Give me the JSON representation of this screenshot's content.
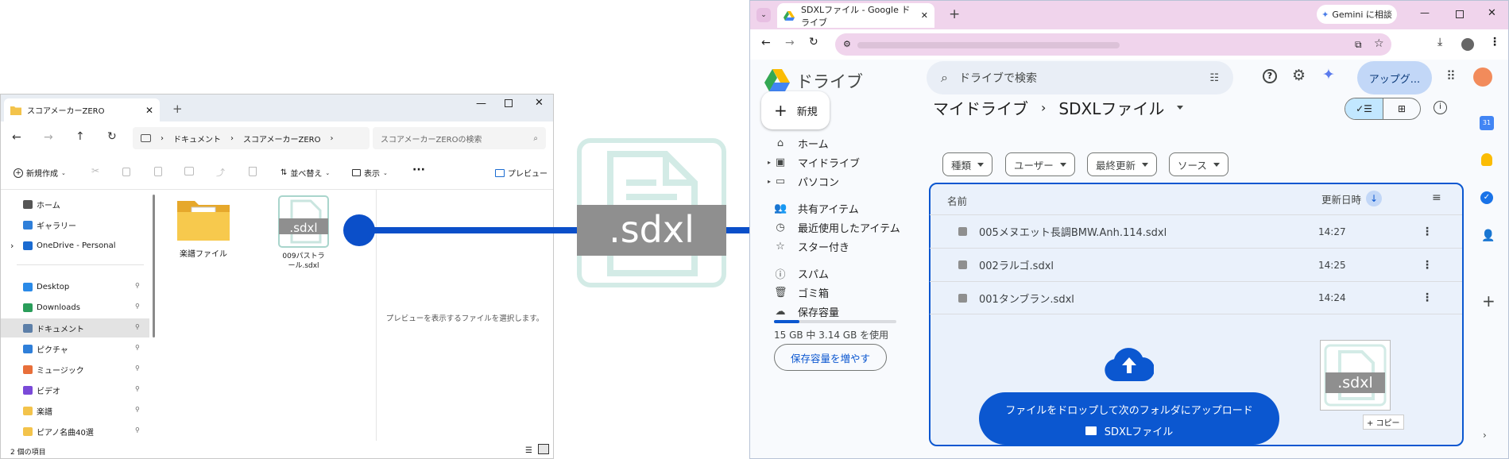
{
  "explorer": {
    "tab_title": "スコアメーカーZERO",
    "breadcrumb": [
      "ドキュメント",
      "スコアメーカーZERO"
    ],
    "search_placeholder": "スコアメーカーZEROの検索",
    "toolbar": {
      "new": "新規作成",
      "sort": "並べ替え",
      "view": "表示",
      "preview": "プレビュー"
    },
    "sidebar": [
      {
        "label": "ホーム",
        "icon": "home-icon"
      },
      {
        "label": "ギャラリー",
        "icon": "gallery-icon"
      },
      {
        "label": "OneDrive - Personal",
        "icon": "onedrive-icon"
      },
      {
        "label": "Desktop",
        "icon": "desktop-icon"
      },
      {
        "label": "Downloads",
        "icon": "downloads-icon"
      },
      {
        "label": "ドキュメント",
        "icon": "documents-icon"
      },
      {
        "label": "ピクチャ",
        "icon": "pictures-icon"
      },
      {
        "label": "ミュージック",
        "icon": "music-icon"
      },
      {
        "label": "ビデオ",
        "icon": "video-icon"
      },
      {
        "label": "楽譜",
        "icon": "folder-icon"
      },
      {
        "label": "ピアノ名曲40選",
        "icon": "folder-icon"
      }
    ],
    "items": [
      {
        "name": "楽譜ファイル",
        "type": "folder"
      },
      {
        "name": "009パストラール.sdxl",
        "type": "sdxl",
        "badge": ".sdxl"
      }
    ],
    "preview_message": "プレビューを表示するファイルを選択します。",
    "status": "2 個の項目"
  },
  "big_icon_label": ".sdxl",
  "colors": {
    "arrow": "#0b4fc9",
    "sdxl_teal": "#cfe7e2",
    "sdxl_gray": "#8f8f8f",
    "drive_blue": "#0b57d0",
    "chrome_tab": "#f0d4ec"
  },
  "chrome": {
    "tab_title": "SDXLファイル - Google ドライブ",
    "gemini_button": "Gemini に相談"
  },
  "drive": {
    "logo_text": "ドライブ",
    "search_placeholder": "ドライブで検索",
    "upgrade_button": "アップグ...",
    "new_button": "新規",
    "nav": [
      {
        "label": "ホーム",
        "icon": "home-icon"
      },
      {
        "label": "マイドライブ",
        "icon": "my-drive-icon"
      },
      {
        "label": "パソコン",
        "icon": "computers-icon"
      },
      {
        "label": "共有アイテム",
        "icon": "shared-icon"
      },
      {
        "label": "最近使用したアイテム",
        "icon": "recent-icon"
      },
      {
        "label": "スター付き",
        "icon": "star-icon"
      },
      {
        "label": "スパム",
        "icon": "spam-icon"
      },
      {
        "label": "ゴミ箱",
        "icon": "trash-icon"
      },
      {
        "label": "保存容量",
        "icon": "cloud-icon"
      }
    ],
    "storage_fraction": 0.21,
    "storage_text": "15 GB 中 3.14 GB を使用",
    "storage_button": "保存容量を増やす",
    "breadcrumb": [
      "マイドライブ",
      "SDXLファイル"
    ],
    "filters": [
      "種類",
      "ユーザー",
      "最終更新",
      "ソース"
    ],
    "columns": {
      "name": "名前",
      "modified": "更新日時"
    },
    "files": [
      {
        "name": "005メヌエット長調BMW.Anh.114.sdxl",
        "time": "14:27"
      },
      {
        "name": "002ラルゴ.sdxl",
        "time": "14:25"
      },
      {
        "name": "001タンブラン.sdxl",
        "time": "14:24"
      }
    ],
    "drop_message": "ファイルをドロップして次のフォルダにアップロード",
    "drop_folder": "SDXLファイル",
    "drag_badge": ".sdxl",
    "copy_label": "+ コピー"
  }
}
